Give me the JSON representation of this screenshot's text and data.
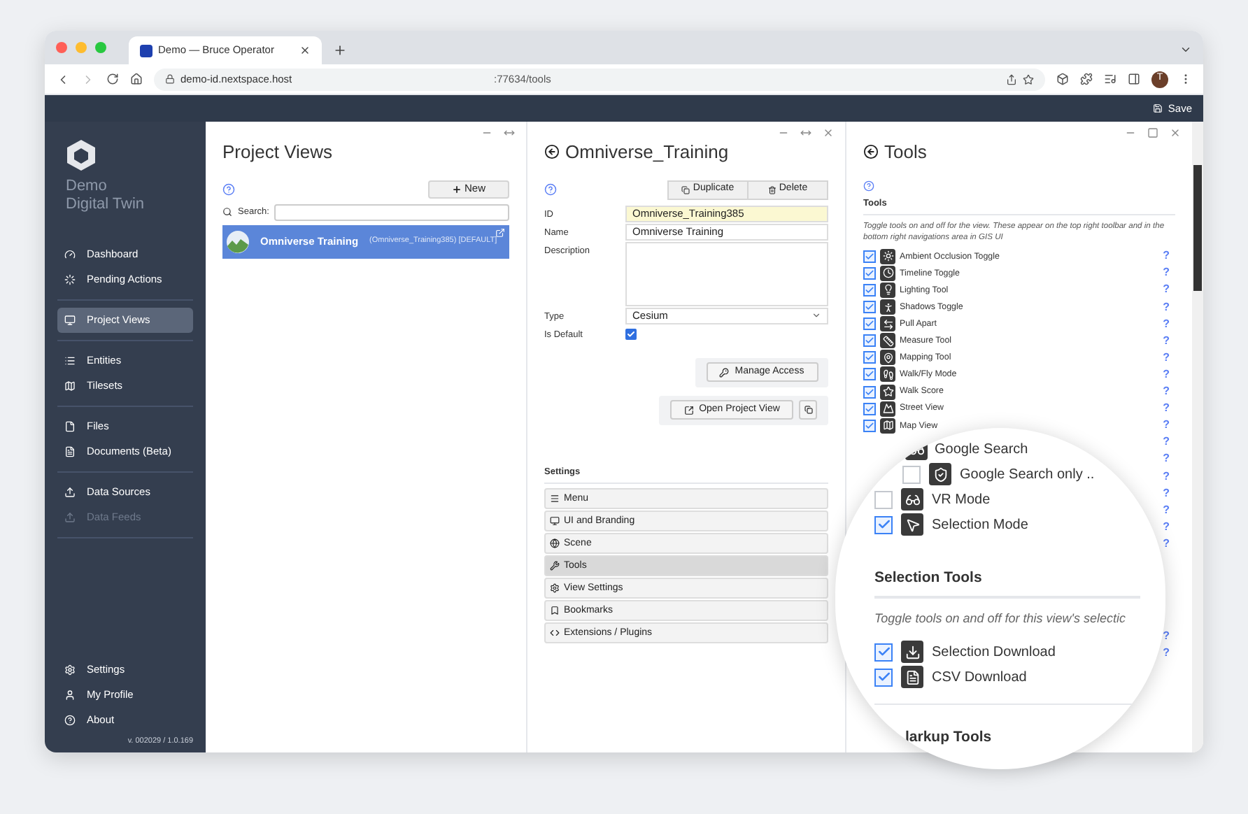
{
  "browser": {
    "tab_title": "Demo — Bruce Operator",
    "url_host": "demo-id.nextspace.host",
    "url_path": ":77634/tools",
    "avatar": "T"
  },
  "app_bar": {
    "save": "Save"
  },
  "sidebar": {
    "brand_line1": "Demo",
    "brand_line2": "Digital Twin",
    "groups": [
      [
        {
          "label": "Dashboard",
          "selected": false,
          "disabled": false
        },
        {
          "label": "Pending Actions",
          "selected": false,
          "disabled": false
        }
      ],
      [
        {
          "label": "Project Views",
          "selected": true,
          "disabled": false
        }
      ],
      [
        {
          "label": "Entities",
          "selected": false,
          "disabled": false
        },
        {
          "label": "Tilesets",
          "selected": false,
          "disabled": false
        }
      ],
      [
        {
          "label": "Files",
          "selected": false,
          "disabled": false
        },
        {
          "label": "Documents (Beta)",
          "selected": false,
          "disabled": false
        }
      ],
      [
        {
          "label": "Data Sources",
          "selected": false,
          "disabled": false
        },
        {
          "label": "Data Feeds",
          "selected": false,
          "disabled": true
        }
      ]
    ],
    "bottom": [
      {
        "label": "Settings"
      },
      {
        "label": "My Profile"
      },
      {
        "label": "About"
      }
    ],
    "version": "v. 002029 / 1.0.169"
  },
  "project_views": {
    "title": "Project Views",
    "new_button": "New",
    "search_label": "Search:",
    "items": [
      {
        "name": "Omniverse Training",
        "meta": "(Omniverse_Training385) [DEFAULT]",
        "selected": true
      }
    ]
  },
  "view_editor": {
    "title": "Omniverse_Training",
    "duplicate": "Duplicate",
    "delete": "Delete",
    "id_label": "ID",
    "id_value": "Omniverse_Training385",
    "name_label": "Name",
    "name_value": "Omniverse Training",
    "description_label": "Description",
    "type_label": "Type",
    "type_value": "Cesium",
    "default_label": "Is Default",
    "is_default": true,
    "manage_access": "Manage Access",
    "open_view": "Open Project View",
    "settings_heading": "Settings",
    "sections": [
      {
        "label": "Menu",
        "selected": false
      },
      {
        "label": "UI and Branding",
        "selected": false
      },
      {
        "label": "Scene",
        "selected": false
      },
      {
        "label": "Tools",
        "selected": true
      },
      {
        "label": "View Settings",
        "selected": false
      },
      {
        "label": "Bookmarks",
        "selected": false
      },
      {
        "label": "Extensions / Plugins",
        "selected": false
      }
    ]
  },
  "tools": {
    "title": "Tools",
    "heading": "Tools",
    "description": "Toggle tools on and off for the view. These appear on the top right toolbar and in the bottom right navigations area in GIS UI",
    "items": [
      {
        "label": "Ambient Occlusion Toggle",
        "checked": true,
        "help": "?"
      },
      {
        "label": "Timeline Toggle",
        "checked": true,
        "help": "?"
      },
      {
        "label": "Lighting Tool",
        "checked": true,
        "help": "?"
      },
      {
        "label": "Shadows Toggle",
        "checked": true,
        "help": "?"
      },
      {
        "label": "Pull Apart",
        "checked": true,
        "help": "?"
      },
      {
        "label": "Measure Tool",
        "checked": true,
        "help": "?"
      },
      {
        "label": "Mapping Tool",
        "checked": true,
        "help": "?"
      },
      {
        "label": "Walk/Fly Mode",
        "checked": true,
        "help": "?"
      },
      {
        "label": "Walk Score",
        "checked": true,
        "help": "?"
      },
      {
        "label": "Street View",
        "checked": true,
        "help": "?"
      },
      {
        "label": "Map View",
        "checked": true,
        "help": "?"
      }
    ],
    "more_help": [
      "?",
      "?",
      "?",
      "?",
      "?",
      "?",
      "?"
    ],
    "selection_help": [
      "?",
      "?"
    ]
  },
  "magnifier": {
    "google_search": "Google Search",
    "google_only": {
      "label": "Google Search only ..",
      "checked": false
    },
    "items": [
      {
        "label": "VR Mode",
        "checked": false
      },
      {
        "label": "Selection Mode",
        "checked": true
      }
    ],
    "selection_heading": "Selection Tools",
    "selection_description": "Toggle tools on and off for this view's selectic",
    "selection_items": [
      {
        "label": "Selection Download",
        "checked": true
      },
      {
        "label": "CSV Download",
        "checked": true
      }
    ],
    "markup_heading": "larkup Tools"
  }
}
